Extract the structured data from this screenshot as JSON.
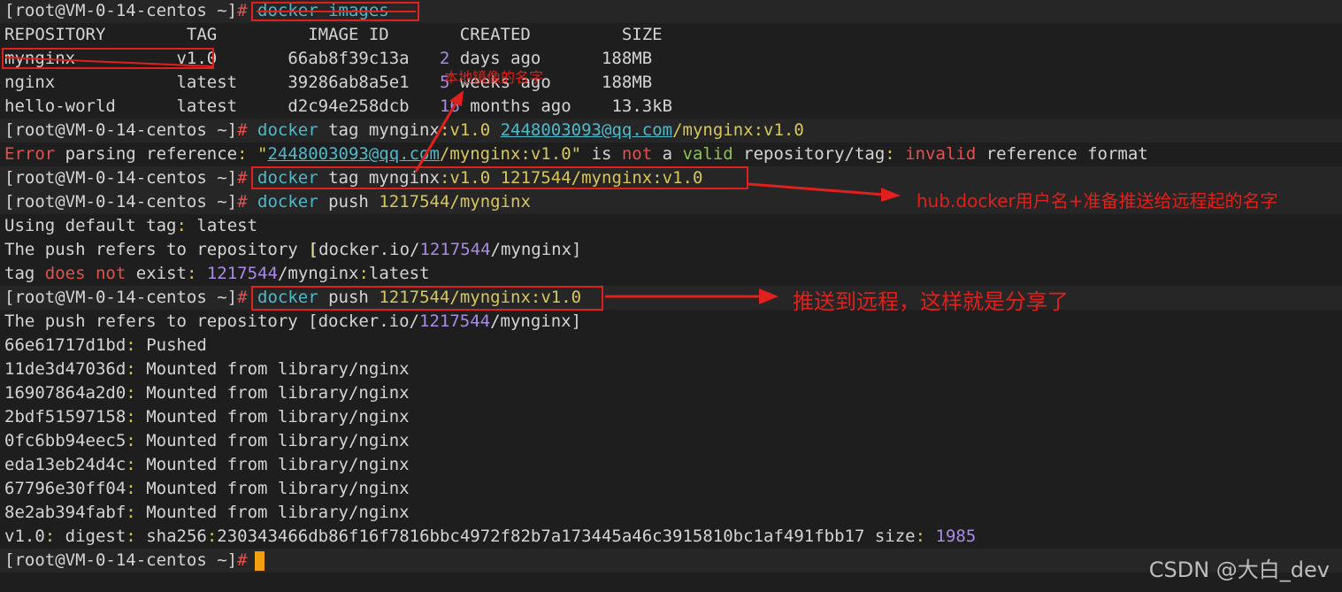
{
  "prompt": "[root@VM-0-14-centos ~]",
  "hash": "#",
  "line_images": "docker images",
  "header": [
    "REPOSITORY",
    "TAG",
    "IMAGE ID",
    "CREATED",
    "SIZE"
  ],
  "images": [
    {
      "repo": "mynginx",
      "tag": "v1.0",
      "id": "66ab8f39c13a",
      "num": "2",
      "created": "days ago",
      "size": "188MB"
    },
    {
      "repo": "nginx",
      "tag": "latest",
      "id": "39286ab8a5e1",
      "num": "5",
      "created": "weeks ago",
      "size": "188MB"
    },
    {
      "repo": "hello-world",
      "tag": "latest",
      "id": "d2c94e258dcb",
      "num": "16",
      "created": "months ago",
      "size": "13.3kB"
    }
  ],
  "cmd_tag1": {
    "a": "docker",
    "b": "tag mynginx",
    "c": ":v1.0",
    "email": "2448003093@qq.com",
    "d": "/mynginx:v1.0"
  },
  "error_line": {
    "error": "Error",
    "t1": " parsing reference",
    ": ": ": ",
    "q1": "\"",
    "email": "2448003093@qq.com",
    "t2": "/mynginx:v1.0\"",
    "is": " is ",
    "not": "not",
    "a": " a ",
    "valid": "valid",
    "t3": " repository/tag",
    "colon": ":",
    "invalid": " invalid",
    "t4": " reference format"
  },
  "cmd_tag2": {
    "a": "docker",
    "b": "tag mynginx",
    "c": ":v1.0",
    "d": "1217544/mynginx:v1.0"
  },
  "cmd_push1": {
    "a": "docker",
    "b": "push",
    "d": "1217544/mynginx"
  },
  "out_default": "Using default tag",
  "out_default_val": "latest",
  "out_refers": "The push refers to repository ",
  "out_repo_a": "[docker.io/",
  "out_repo_b": "1217544",
  "out_repo_c": "/mynginx]",
  "out_tag": "tag ",
  "out_does": "does",
  "out_not": "not",
  "out_exist": " exist",
  "out_tag_num": "1217544",
  "out_tag_rest": "/mynginx",
  "out_tag_latest": "latest",
  "cmd_push2": {
    "a": "docker",
    "b": "push",
    "d": "1217544/mynginx:v1.0"
  },
  "layers": [
    {
      "id": "66e61717d1bd",
      "status": "Pushed"
    },
    {
      "id": "11de3d47036d",
      "status": "Mounted from library/nginx"
    },
    {
      "id": "16907864a2d0",
      "status": "Mounted from library/nginx"
    },
    {
      "id": "2bdf51597158",
      "status": "Mounted from library/nginx"
    },
    {
      "id": "0fc6bb94eec5",
      "status": "Mounted from library/nginx"
    },
    {
      "id": "eda13eb24d4c",
      "status": "Mounted from library/nginx"
    },
    {
      "id": "67796e30ff04",
      "status": "Mounted from library/nginx"
    },
    {
      "id": "8e2ab394fabf",
      "status": "Mounted from library/nginx"
    }
  ],
  "digest": {
    "tag": "v1.0",
    "label": " digest",
    "sha": "sha256",
    "hash": "230343466db86f16f7816bbc4972f82b7a173445a46c3915810bc1af491fbb17",
    "size_label": " size",
    "size": "1985"
  },
  "annotations": {
    "local_name": "本地镜像的名字",
    "hub_name": "hub.docker用户名+准备推送给远程起的名字",
    "push_remote": "推送到远程，这样就是分享了"
  },
  "watermark": "CSDN @大白_dev",
  "colors": {
    "annotation": "#e0201c",
    "cyan": "#4fb8c9",
    "yellow": "#d7c75a",
    "purple": "#a98be6",
    "cursor": "#f0a010"
  }
}
